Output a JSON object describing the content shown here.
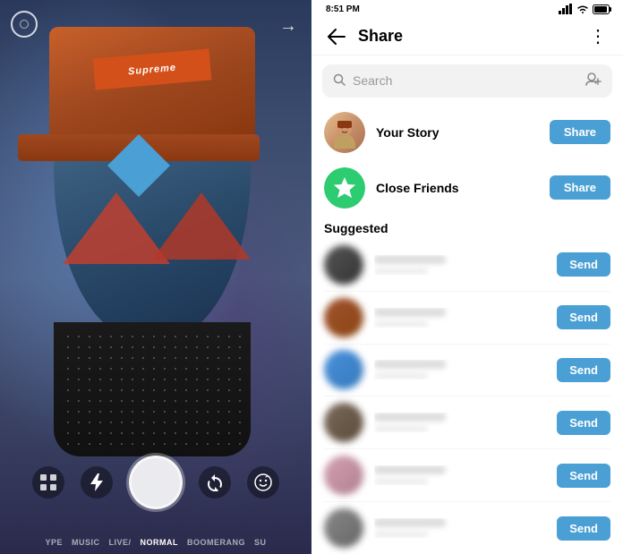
{
  "camera": {
    "hat_label": "Supreme",
    "mode_items": [
      "YPE",
      "MUSIC",
      "LIVE/",
      "NORMAL",
      "BOOMERANG",
      "SU"
    ]
  },
  "status_bar": {
    "time": "8:51 PM"
  },
  "header": {
    "title": "Share",
    "back_label": "←",
    "more_label": "⋮"
  },
  "search": {
    "placeholder": "Search",
    "add_people_icon": "add-people"
  },
  "story_items": [
    {
      "name": "Your Story",
      "button_label": "Share"
    },
    {
      "name": "Close Friends",
      "button_label": "Share"
    }
  ],
  "suggested": {
    "label": "Suggested",
    "send_label": "Send",
    "users": [
      {
        "id": 1
      },
      {
        "id": 2
      },
      {
        "id": 3
      },
      {
        "id": 4
      },
      {
        "id": 5
      },
      {
        "id": 6
      }
    ]
  }
}
